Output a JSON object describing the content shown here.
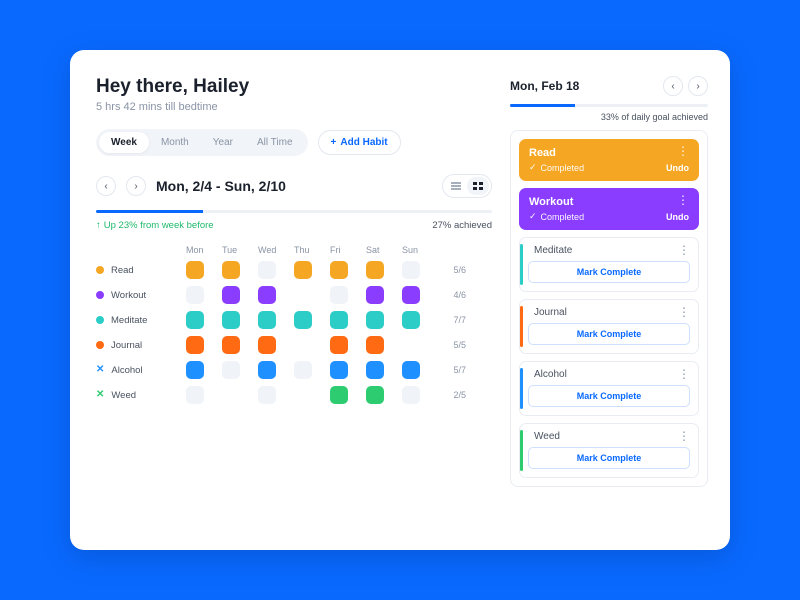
{
  "greeting": "Hey there, Hailey",
  "subtitle": "5 hrs 42 mins till bedtime",
  "period_tabs": [
    "Week",
    "Month",
    "Year",
    "All Time"
  ],
  "period_active": 0,
  "add_habit_label": "Add Habit",
  "date_range": "Mon, 2/4 - Sun, 2/10",
  "week_progress_pct": 27,
  "trend_text": "Up 23% from week before",
  "achieved_text": "27% achieved",
  "days": [
    "Mon",
    "Tue",
    "Wed",
    "Thu",
    "Fri",
    "Sat",
    "Sun"
  ],
  "colors": {
    "read": "#f5a623",
    "workout": "#8b3dff",
    "meditate": "#2cccc7",
    "journal": "#ff6a13",
    "alcohol": "#1e90ff",
    "weed": "#2ecc71",
    "empty": "#f0f3f7",
    "accent": "#0969ff"
  },
  "habits": [
    {
      "key": "read",
      "name": "Read",
      "marker": "dot",
      "count": "5/6",
      "cells": [
        "c",
        "c",
        "e",
        "c",
        "c",
        "c",
        "e"
      ]
    },
    {
      "key": "workout",
      "name": "Workout",
      "marker": "dot",
      "count": "4/6",
      "cells": [
        "e",
        "c",
        "c",
        "",
        "e",
        "c",
        "c"
      ]
    },
    {
      "key": "meditate",
      "name": "Meditate",
      "marker": "dot",
      "count": "7/7",
      "cells": [
        "c",
        "c",
        "c",
        "c",
        "c",
        "c",
        "c"
      ]
    },
    {
      "key": "journal",
      "name": "Journal",
      "marker": "dot",
      "count": "5/5",
      "cells": [
        "c",
        "c",
        "c",
        "",
        "c",
        "c",
        ""
      ]
    },
    {
      "key": "alcohol",
      "name": "Alcohol",
      "marker": "x",
      "count": "5/7",
      "cells": [
        "c",
        "e",
        "c",
        "e",
        "c",
        "c",
        "c"
      ]
    },
    {
      "key": "weed",
      "name": "Weed",
      "marker": "x",
      "count": "2/5",
      "cells": [
        "e",
        "",
        "e",
        "",
        "c",
        "c",
        "e"
      ]
    }
  ],
  "right": {
    "date": "Mon, Feb 18",
    "progress_pct": 33,
    "progress_text": "33% of daily goal achieved",
    "completed_label": "Completed",
    "undo_label": "Undo",
    "mark_complete_label": "Mark Complete",
    "done": [
      {
        "key": "read",
        "name": "Read"
      },
      {
        "key": "workout",
        "name": "Workout"
      }
    ],
    "todo": [
      {
        "key": "meditate",
        "name": "Meditate"
      },
      {
        "key": "journal",
        "name": "Journal"
      },
      {
        "key": "alcohol",
        "name": "Alcohol"
      },
      {
        "key": "weed",
        "name": "Weed"
      }
    ]
  }
}
